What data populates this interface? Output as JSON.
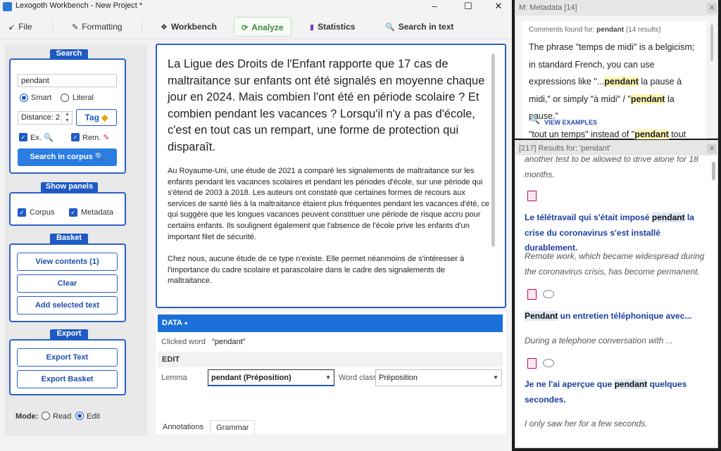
{
  "window": {
    "title": "Lexogoth Workbench - New Project *",
    "minimize": "–",
    "maximize": "☐",
    "close": "✕"
  },
  "toolbar": {
    "tabs": [
      {
        "icon": "↙",
        "label": "File"
      },
      {
        "icon": "✎",
        "label": "Formatting"
      },
      {
        "icon": "❖",
        "label": "Workbench"
      },
      {
        "icon": "⟳",
        "label": "Analyze"
      },
      {
        "icon": "▮",
        "label": "Statistics"
      },
      {
        "icon": "🔍",
        "label": "Search in text"
      }
    ]
  },
  "search": {
    "title": "Search",
    "query": "pendant",
    "smart_label": "Smart",
    "literal_label": "Literal",
    "distance_value": "Distance: 2",
    "tag_label": "Tag",
    "ex_label": "Ex.",
    "rem_label": "Rem.",
    "search_button": "Search in corpus"
  },
  "panels": {
    "title": "Show panels",
    "corpus_label": "Corpus",
    "metadata_label": "Metadata"
  },
  "basket": {
    "title": "Basket",
    "view_contents": "View contents (1)",
    "clear": "Clear",
    "add_selected": "Add selected text"
  },
  "export": {
    "title": "Export",
    "export_text": "Export Text",
    "export_basket": "Export Basket"
  },
  "mode": {
    "label": "Mode:",
    "read": "Read",
    "edit": "Edit"
  },
  "document": {
    "headline": "La Ligue des Droits de l'Enfant rapporte que 17 cas de maltraitance sur enfants ont été signalés en moyenne chaque jour en 2024. Mais combien l'ont été en période scolaire ? Et combien pendant les vacances ? Lorsqu'il n'y a pas d'école, c'est en tout cas un rempart, une forme de protection qui disparaît.",
    "para1": "Au Royaume-Uni, une étude de 2021 a comparé les signalements de maltraitance sur les enfants pendant les vacances scolaires et pendant les périodes d'école, sur une période qui s'étend de 2003 à 2018. Les auteurs ont constaté que certaines formes de recours aux services de santé liés à la maltraitance étaient plus fréquentes pendant les vacances d'été, ce qui suggère que les longues vacances peuvent constituer une période de risque accru pour certains enfants. Ils soulignent également que l'absence de l'école prive les enfants d'un important filet de sécurité.",
    "para2": "Chez nous, aucune étude de ce type n'existe. Elle permet néanmoins de s'intéresser à l'importance du cadre scolaire et parascolaire dans le cadre des signalements de maltraitance."
  },
  "inspector": {
    "data_header": "DATA",
    "clicked_word_label": "Clicked word",
    "clicked_word_value": "\"pendant\"",
    "edit_header": "EDIT",
    "lemma_label": "Lemma",
    "lemma_value": "pendant (Préposition)",
    "word_class_label": "Word class",
    "word_class_value": "Préposition",
    "tabs": [
      "Annotations",
      "Grammar"
    ]
  },
  "metadata": {
    "title": "M: Metadata [14]",
    "found_prefix": "Comments found for:",
    "found_word": "pendant",
    "found_count": "(14 results)",
    "text_a": "The phrase \"temps de midi\" is a belgicism; in standard French, you can use expressions like \"...",
    "hl_1": "pendant",
    "text_b": " la pause à midi,\" or simply \"à midi\" / \"",
    "hl_2": "pendant",
    "text_c": " la pause.\"",
    "view_examples": "VIEW EXAMPLES",
    "text2_a": "\"tout un temps\" instead of \"",
    "text2_hl": "pendant",
    "text2_b": " tout"
  },
  "results": {
    "title": "[217] Results for: 'pendant'",
    "partial_en": "another test to be allowed to drive alone for 18 months.",
    "items": [
      {
        "fr_a": "Le télétravail qui s'était imposé ",
        "fr_hl": "pendant",
        "fr_b": " la crise du coronavirus s'est installé durablement.",
        "en": "Remote work, which became widespread during the coronavirus crisis, has become permanent."
      },
      {
        "fr_a": "",
        "fr_hl": "Pendant",
        "fr_b": " un entretien téléphonique avec...",
        "en": "During a telephone conversation with ..."
      },
      {
        "fr_a": "Je ne l'ai aperçue que ",
        "fr_hl": "pendant",
        "fr_b": " quelques secondes.",
        "en": "I only saw her for a few seconds."
      }
    ]
  }
}
